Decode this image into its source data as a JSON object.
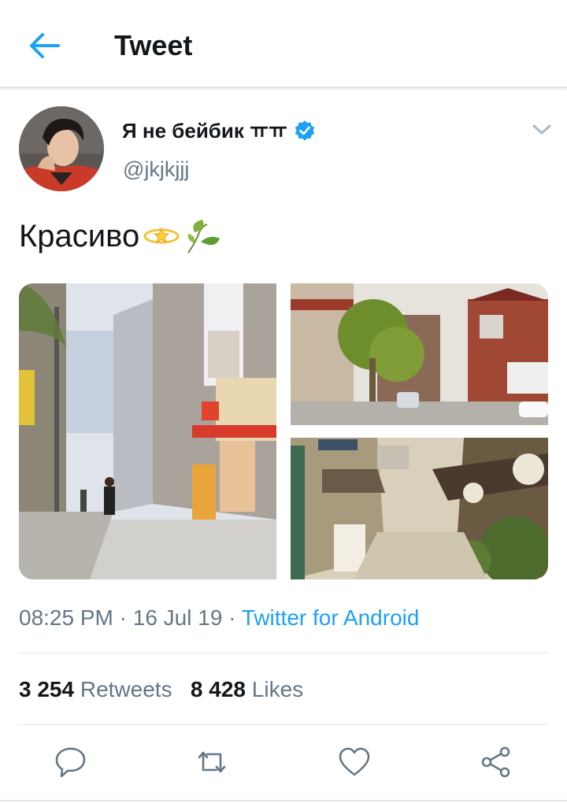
{
  "header": {
    "title": "Tweet",
    "back_icon": "arrow-left-icon"
  },
  "tweet": {
    "author_name": "Я не бейбик ㅠㅠ",
    "verified": true,
    "handle": "@jkjkjjj",
    "text": "Красиво",
    "emojis": [
      "dizzy-halo-icon",
      "leaf-icon"
    ],
    "time": "08:25 PM",
    "date": "16 Jul 19",
    "separator": "·",
    "source": "Twitter for Android",
    "retweets_count": "3 254",
    "retweets_label": "Retweets",
    "likes_count": "8 428",
    "likes_label": "Likes",
    "photos": [
      "street-photo",
      "house-photo",
      "alley-photo"
    ]
  },
  "actions": [
    "reply-icon",
    "retweet-icon",
    "like-icon",
    "share-icon"
  ],
  "colors": {
    "accent": "#1da1f2",
    "secondary_text": "#657786",
    "primary_text": "#14171a",
    "divider": "#e1e8ed"
  }
}
